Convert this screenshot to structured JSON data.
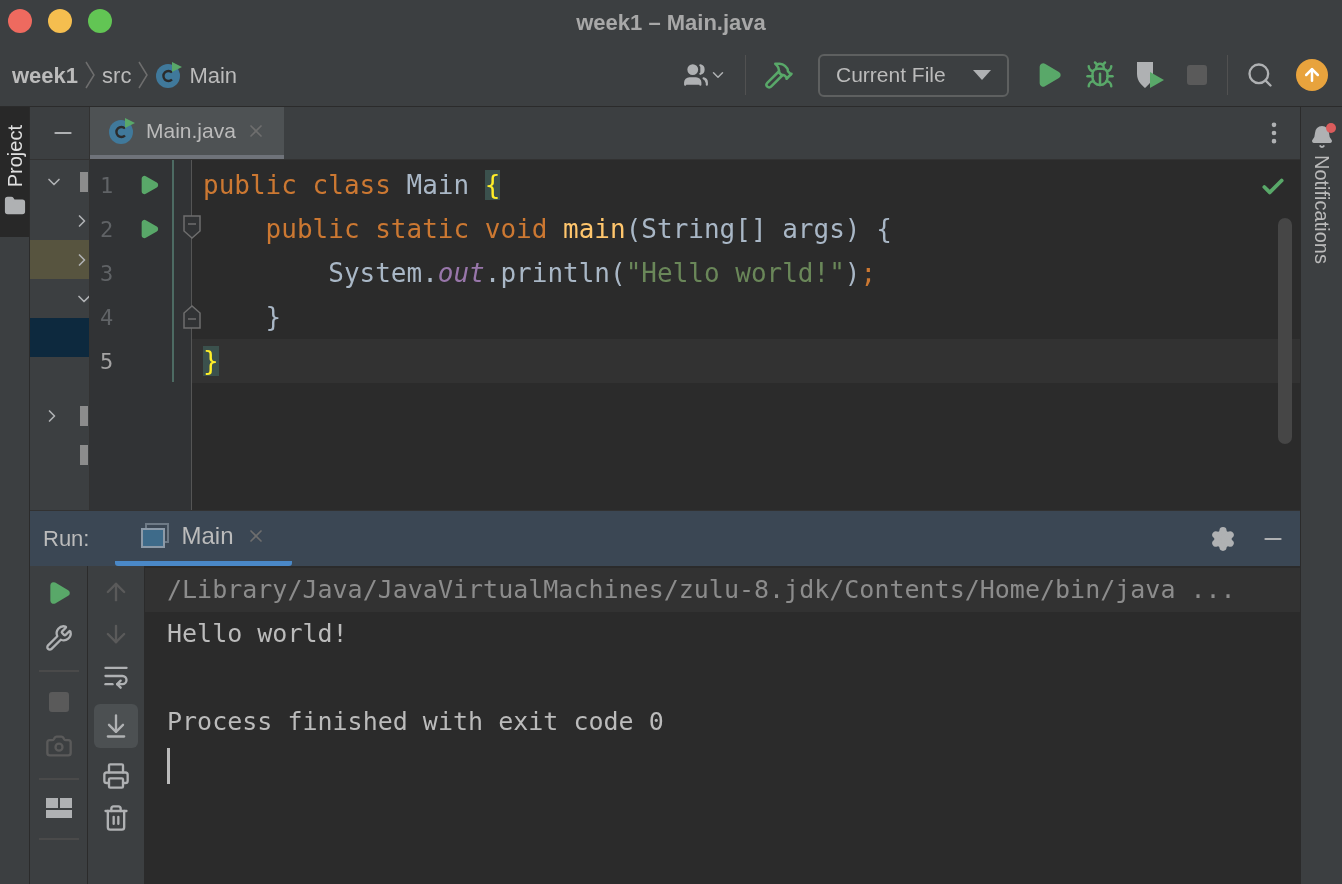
{
  "window": {
    "title": "week1 – Main.java"
  },
  "breadcrumbs": [
    {
      "label": "week1",
      "kind": "project"
    },
    {
      "label": "src",
      "kind": "folder"
    },
    {
      "label": "Main",
      "kind": "class"
    }
  ],
  "toolbar": {
    "run_configuration": "Current File",
    "stop_enabled": false
  },
  "left_tool_windows": [
    {
      "label": "Project",
      "selected": true
    }
  ],
  "project_tree": [
    {
      "expanded": true,
      "selected": false,
      "highlighted": false,
      "children": [
        {
          "expanded": false,
          "selected": false,
          "highlighted": false
        },
        {
          "expanded": false,
          "selected": false,
          "highlighted": true
        },
        {
          "expanded": true,
          "selected": false,
          "highlighted": false,
          "children": [
            {
              "selected": true,
              "highlighted": false
            },
            {
              "selected": false,
              "highlighted": false
            }
          ]
        }
      ]
    },
    {
      "expanded": false,
      "selected": false,
      "highlighted": false
    },
    {
      "selected": false,
      "highlighted": false
    }
  ],
  "editor": {
    "tabs": [
      {
        "label": "Main.java",
        "selected": true
      }
    ],
    "inspection_ok": true,
    "lines": [
      {
        "number": "1",
        "runnable": true,
        "fold_start": false,
        "fold_end": false,
        "current": false,
        "tokens": [
          {
            "kind": "keyword",
            "text": "public "
          },
          {
            "kind": "keyword",
            "text": "class "
          },
          {
            "kind": "plain",
            "text": "Main "
          },
          {
            "kind": "brace-match",
            "text": "{"
          }
        ]
      },
      {
        "number": "2",
        "runnable": true,
        "fold_start": true,
        "fold_end": false,
        "current": false,
        "tokens": [
          {
            "kind": "keyword",
            "text": "    public "
          },
          {
            "kind": "keyword",
            "text": "static "
          },
          {
            "kind": "keyword",
            "text": "void "
          },
          {
            "kind": "method",
            "text": "main"
          },
          {
            "kind": "plain",
            "text": "(String[] args) {"
          }
        ]
      },
      {
        "number": "3",
        "runnable": false,
        "fold_start": false,
        "fold_end": false,
        "current": false,
        "tokens": [
          {
            "kind": "plain",
            "text": "        System."
          },
          {
            "kind": "field",
            "text": "out"
          },
          {
            "kind": "plain",
            "text": ".println("
          },
          {
            "kind": "string",
            "text": "\"Hello world!\""
          },
          {
            "kind": "plain",
            "text": ")"
          },
          {
            "kind": "punct",
            "text": ";"
          }
        ]
      },
      {
        "number": "4",
        "runnable": false,
        "fold_start": false,
        "fold_end": true,
        "current": false,
        "tokens": [
          {
            "kind": "plain",
            "text": "    }"
          }
        ]
      },
      {
        "number": "5",
        "runnable": false,
        "fold_start": false,
        "fold_end": false,
        "current": true,
        "tokens": [
          {
            "kind": "brace-match",
            "text": "}"
          }
        ]
      }
    ]
  },
  "run_panel": {
    "label": "Run:",
    "running": false,
    "tabs": [
      {
        "label": "Main",
        "selected": true
      }
    ],
    "console": [
      {
        "kind": "command",
        "text": "/Library/Java/JavaVirtualMachines/zulu-8.jdk/Contents/Home/bin/java ..."
      },
      {
        "kind": "output",
        "text": "Hello world!"
      },
      {
        "kind": "blank"
      },
      {
        "kind": "output",
        "text": "Process finished with exit code 0"
      }
    ]
  },
  "right_tool_windows": [
    {
      "label": "Notifications",
      "badge": true
    }
  ]
}
